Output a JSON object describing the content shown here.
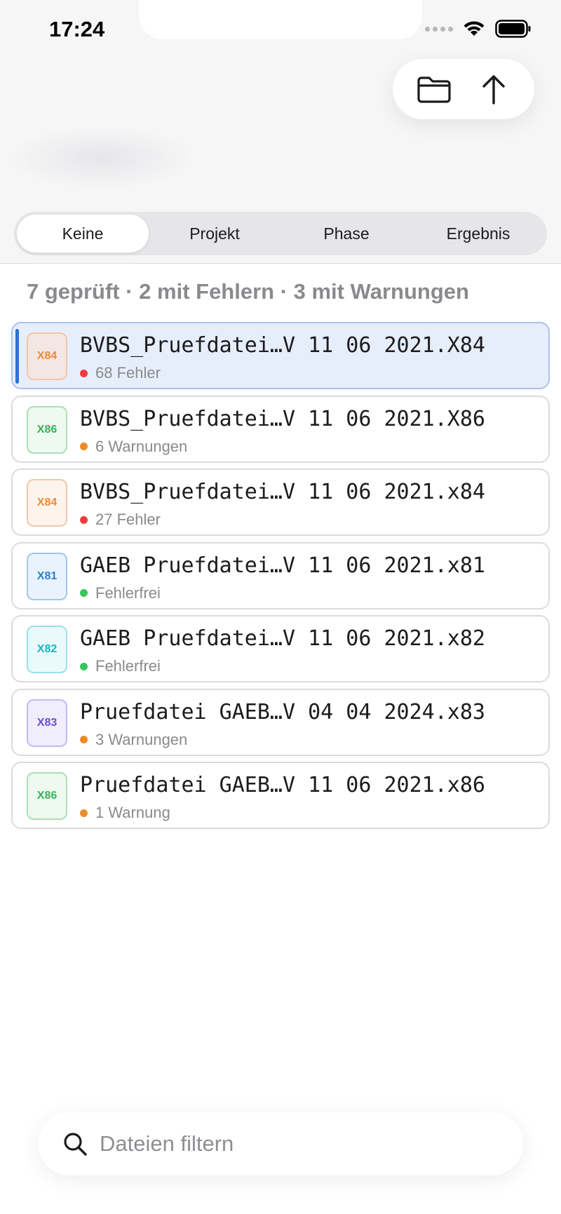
{
  "status_bar": {
    "time": "17:24"
  },
  "segments": [
    {
      "label": "Keine",
      "active": true
    },
    {
      "label": "Projekt",
      "active": false
    },
    {
      "label": "Phase",
      "active": false
    },
    {
      "label": "Ergebnis",
      "active": false
    }
  ],
  "summary": "7 geprüft · 2 mit Fehlern · 3 mit Warnungen",
  "files": [
    {
      "name": "BVBS_Pruefdatei…V 11 06 2021.X84",
      "badge": "X84",
      "status": "68 Fehler",
      "status_color": "#ef3b3b",
      "badge_color": "#ef8a3a",
      "badge_bg": "#f3e7e3",
      "badge_border": "#f3c6a6",
      "selected": true
    },
    {
      "name": "BVBS_Pruefdatei…V 11 06 2021.X86",
      "badge": "X86",
      "status": "6 Warnungen",
      "status_color": "#f08a24",
      "badge_color": "#36b45a",
      "badge_bg": "#eef9f0",
      "badge_border": "#a9e0b6",
      "selected": false
    },
    {
      "name": "BVBS_Pruefdatei…V 11 06 2021.x84",
      "badge": "X84",
      "status": "27 Fehler",
      "status_color": "#ef3b3b",
      "badge_color": "#ef8a3a",
      "badge_bg": "#fff4ec",
      "badge_border": "#f3c6a6",
      "selected": false
    },
    {
      "name": "GAEB Pruefdatei…V 11 06 2021.x81",
      "badge": "X81",
      "status": "Fehlerfrei",
      "status_color": "#34c759",
      "badge_color": "#2a7fd4",
      "badge_bg": "#e9f3fd",
      "badge_border": "#9fc9f0",
      "selected": false
    },
    {
      "name": "GAEB Pruefdatei…V 11 06 2021.x82",
      "badge": "X82",
      "status": "Fehlerfrei",
      "status_color": "#34c759",
      "badge_color": "#1ab3c4",
      "badge_bg": "#eafafb",
      "badge_border": "#98e2ea",
      "selected": false
    },
    {
      "name": "Pruefdatei GAEB…V 04 04 2024.x83",
      "badge": "X83",
      "status": "3 Warnungen",
      "status_color": "#f08a24",
      "badge_color": "#6a4fd1",
      "badge_bg": "#f0edfc",
      "badge_border": "#c5b9f0",
      "selected": false
    },
    {
      "name": "Pruefdatei GAEB…V 11 06 2021.x86",
      "badge": "X86",
      "status": "1 Warnung",
      "status_color": "#f08a24",
      "badge_color": "#36b45a",
      "badge_bg": "#eef9f0",
      "badge_border": "#a9e0b6",
      "selected": false
    }
  ],
  "search": {
    "placeholder": "Dateien filtern",
    "value": ""
  },
  "icons": {
    "folder": "folder-icon",
    "share": "arrow-up-icon",
    "search": "search-icon"
  },
  "colors": {
    "accent": "#2f6fdc",
    "error": "#ef3b3b",
    "warning": "#f08a24",
    "ok": "#34c759"
  }
}
